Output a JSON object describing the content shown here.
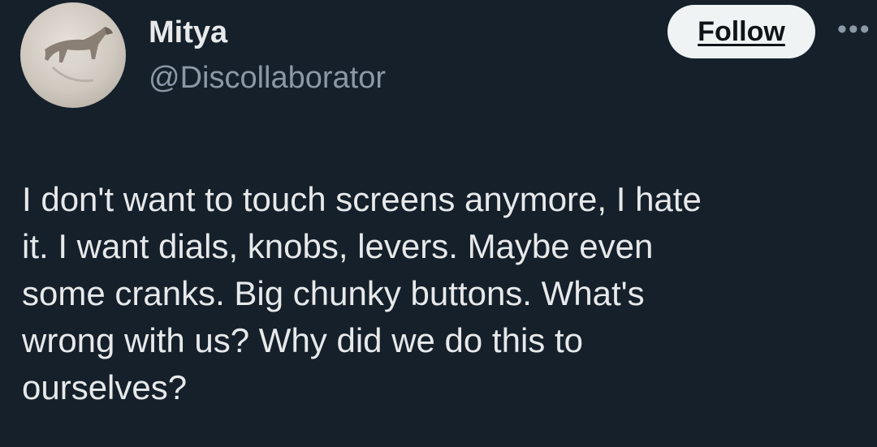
{
  "tweet": {
    "author": {
      "display_name": "Mitya",
      "handle": "@Discollaborator",
      "avatar_icon": "animal-photo-avatar"
    },
    "follow_label": "Follow",
    "more_icon": "ellipsis-icon",
    "more_glyph": "•••",
    "text": "I don't want to touch screens anymore, I hate\nit. I want dials, knobs, levers. Maybe even\nsome cranks. Big chunky buttons. What's\nwrong with us? Why did we do this to\nourselves?"
  },
  "colors": {
    "background": "#15202b",
    "primary_text": "#e7e9ea",
    "secondary_text": "#8b98a5",
    "follow_button_bg": "#eff3f4",
    "follow_button_text": "#0f1419"
  }
}
